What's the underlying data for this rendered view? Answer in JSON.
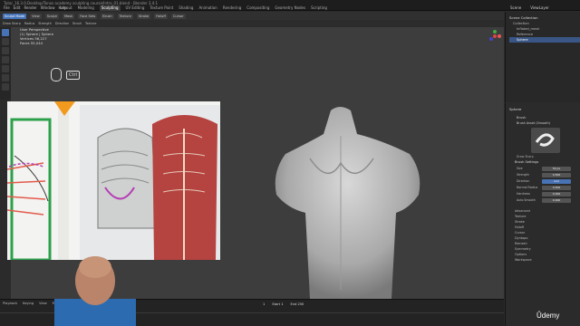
{
  "window": {
    "title": "Tutor_16.3.0.Desktop/Tonos academy sculpting course/Intro_01.blend - Blender 3.4.1"
  },
  "menubar": {
    "items": [
      "File",
      "Edit",
      "Render",
      "Window",
      "Help"
    ],
    "workspaces": [
      "Layout",
      "Modeling",
      "Sculpting",
      "UV Editing",
      "Texture Paint",
      "Shading",
      "Animation",
      "Rendering",
      "Compositing",
      "Geometry Nodes",
      "Scripting"
    ],
    "active_workspace": "Sculpting"
  },
  "scene": {
    "name": "Scene",
    "view_layer": "ViewLayer"
  },
  "header": {
    "mode": "Sculpt Mode",
    "buttons": [
      "View",
      "Sculpt",
      "Mask",
      "Face Sets"
    ],
    "brush": "Brush",
    "texture": "Texture",
    "stroke": "Stroke",
    "falloff": "Falloff",
    "cursor": "Cursor"
  },
  "header2": {
    "items": [
      "Draw Sharp",
      "Radius",
      "Strength",
      "Direction",
      "Brush",
      "Texture"
    ]
  },
  "overlay": {
    "line1": "User Perspective",
    "line2": "(1) Sphere | Sphere",
    "line3": "Vertices  56,227",
    "line4": "Faces  55,044",
    "key": "Ctrl"
  },
  "outliner": {
    "title": "Scene Collection",
    "items": [
      "Collection",
      "Inflated_mesh",
      "Reference",
      "Sphere"
    ],
    "selected": "Sphere"
  },
  "properties": {
    "object": "Sphere",
    "brush_label": "Brush",
    "brush_name": "Brush Asset (Smooth)",
    "brush_preview": "Draw Sharp",
    "section": "Brush Settings",
    "rows": [
      {
        "label": "Size",
        "value": "50 px"
      },
      {
        "label": "Strength",
        "value": "0.500"
      },
      {
        "label": "Direction",
        "value": "Add"
      },
      {
        "label": "Normal Radius",
        "value": "0.500"
      },
      {
        "label": "Hardness",
        "value": "0.000"
      },
      {
        "label": "Auto Smooth",
        "value": "0.000"
      }
    ],
    "subsections": [
      "Advanced",
      "Texture",
      "Stroke",
      "Falloff",
      "Cursor",
      "Dyntopo",
      "Remesh",
      "Symmetry",
      "Options",
      "Workspace"
    ]
  },
  "timeline": {
    "menus": [
      "Playback",
      "Keying",
      "View",
      "Marker"
    ],
    "frame": "1",
    "start": "Start 1",
    "end": "End 250"
  },
  "watermark": "Ûdemy",
  "colors": {
    "accent": "#4772b3",
    "bg": "#3d3d3d",
    "ref_green": "#2ca14c",
    "ref_orange": "#f29a1e"
  }
}
